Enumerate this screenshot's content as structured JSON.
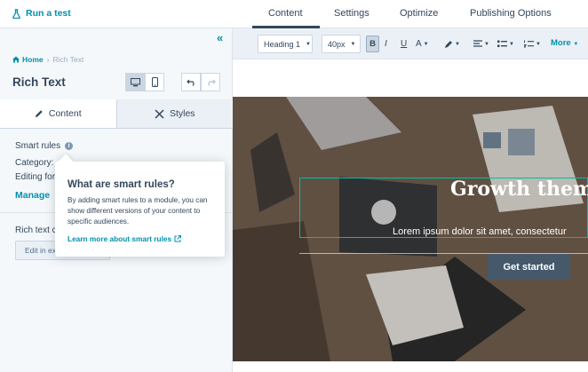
{
  "header": {
    "run_test": "Run a test",
    "tabs": [
      {
        "label": "Content",
        "active": true
      },
      {
        "label": "Settings",
        "active": false
      },
      {
        "label": "Optimize",
        "active": false
      },
      {
        "label": "Publishing Options",
        "active": false
      }
    ]
  },
  "sidebar": {
    "collapse_icon": "double-chevron-left-icon",
    "breadcrumb": {
      "home": "Home",
      "current": "Rich Text"
    },
    "module_title": "Rich Text",
    "tabs": {
      "content": "Content",
      "styles": "Styles"
    },
    "smart_rules_label": "Smart rules",
    "category_label": "Category:",
    "category_value": "",
    "editing_label": "Editing for",
    "manage_link": "Manage",
    "rich_text_label": "Rich text c",
    "edit_button": "Edit in ex"
  },
  "popover": {
    "title": "What are smart rules?",
    "body": "By adding smart rules to a module, you can show different versions of your content to specific audiences.",
    "link": "Learn more about smart rules"
  },
  "toolbar": {
    "heading_select": "Heading 1",
    "size_select": "40px",
    "bold": "B",
    "italic": "I",
    "underline": "U",
    "text_color": "A",
    "more": "More"
  },
  "hero": {
    "title": "Growth them",
    "subtitle": "Lorem ipsum dolor sit amet, consectetur",
    "cta": "Get started"
  },
  "colors": {
    "accent": "#0091ae",
    "text": "#33475b",
    "selection": "#00bda5",
    "cta_bg": "#45596b"
  }
}
